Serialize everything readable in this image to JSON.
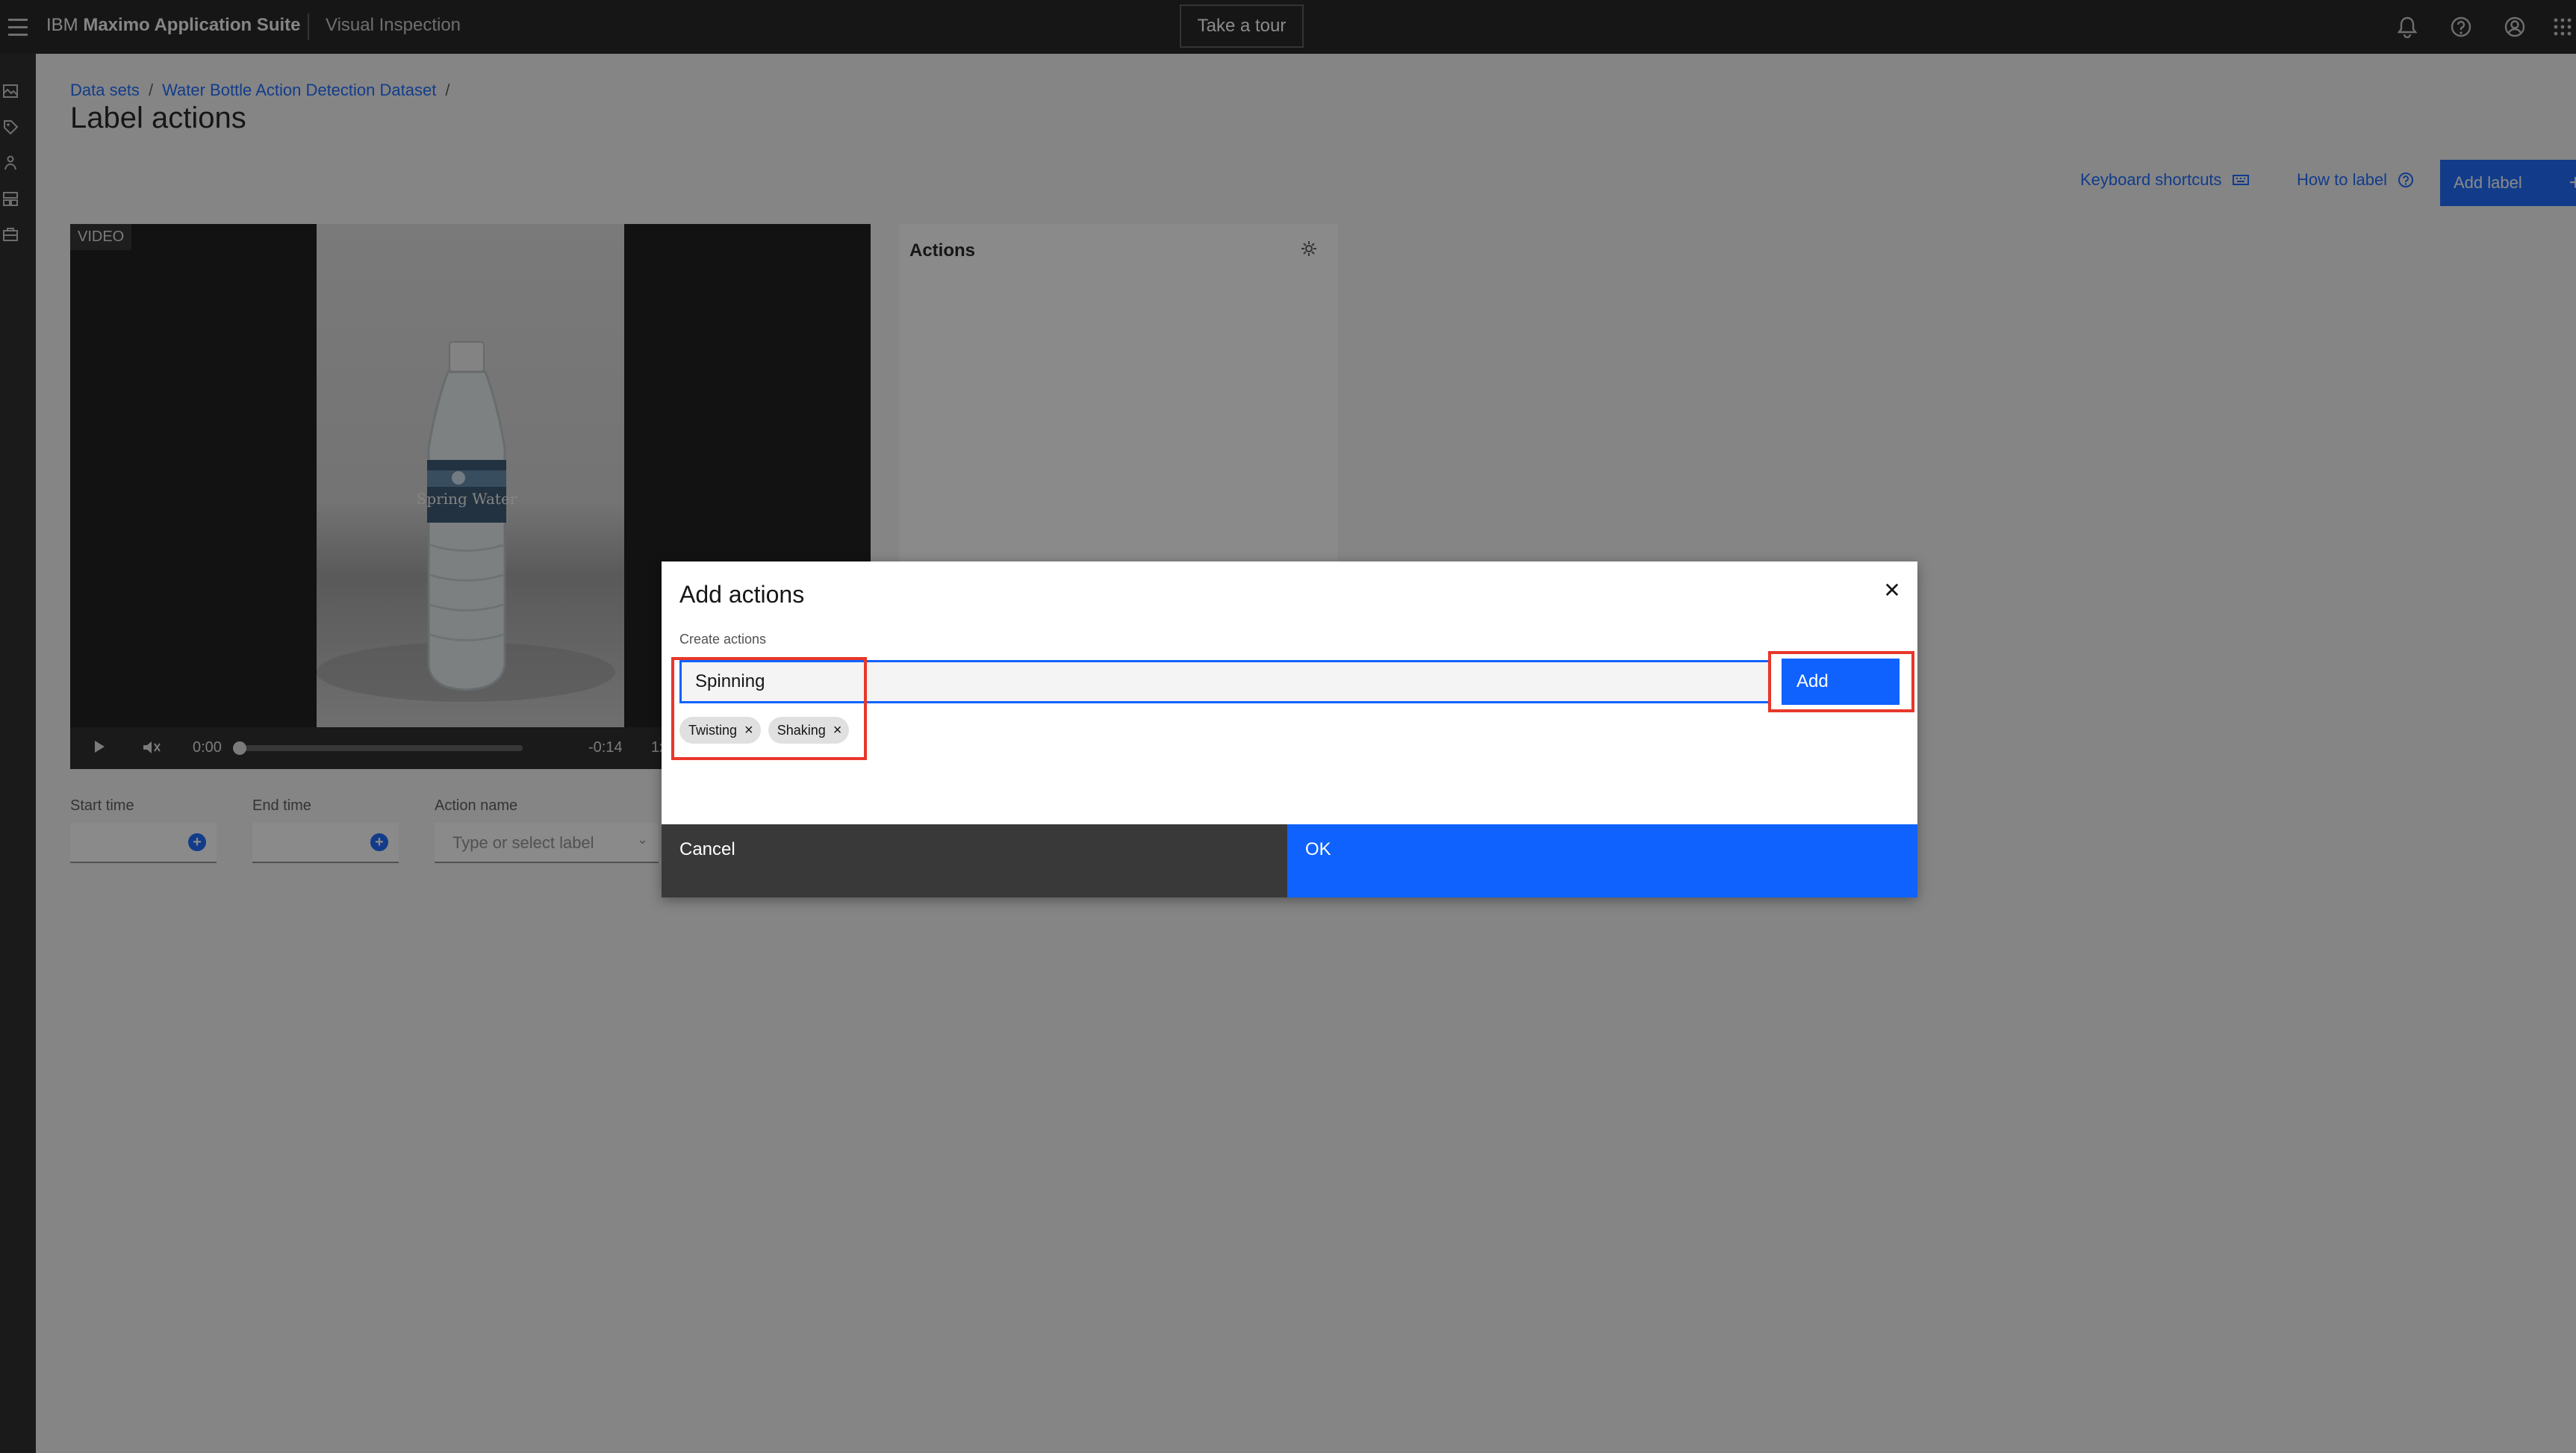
{
  "header": {
    "brand_prefix": "IBM",
    "brand_name": "Maximo Application Suite",
    "product": "Visual Inspection",
    "tour_button": "Take a tour",
    "icons": [
      "notification-icon",
      "help-icon",
      "user-avatar-icon",
      "app-switcher-icon"
    ]
  },
  "sidebar": {
    "icons": [
      "datasets-icon",
      "labels-icon",
      "train-icon",
      "models-icon",
      "deploy-icon"
    ]
  },
  "breadcrumb": {
    "items": [
      "Data sets",
      "Water Bottle Action Detection Dataset"
    ],
    "separator": "/"
  },
  "page": {
    "title": "Label actions"
  },
  "toolbar": {
    "keyboard_shortcuts": "Keyboard shortcuts",
    "how_to_label": "How to label",
    "add_label": "Add label"
  },
  "video": {
    "tag": "VIDEO",
    "bottle_label_text": "Spring Water",
    "current_time": "0:00",
    "remaining_time": "-0:14",
    "speed": "1x",
    "progress": 0
  },
  "actions_panel": {
    "title": "Actions"
  },
  "form": {
    "start_time_label": "Start time",
    "end_time_label": "End time",
    "action_name_label": "Action name",
    "action_name_placeholder": "Type or select label"
  },
  "modal": {
    "title": "Add actions",
    "field_label": "Create actions",
    "input_value": "Spinning",
    "add_button": "Add",
    "tags": [
      "Twisting",
      "Shaking"
    ],
    "cancel_button": "Cancel",
    "ok_button": "OK"
  },
  "colors": {
    "primary": "#0f62fe",
    "header_bg": "#161616",
    "highlight": "#e8372a"
  }
}
